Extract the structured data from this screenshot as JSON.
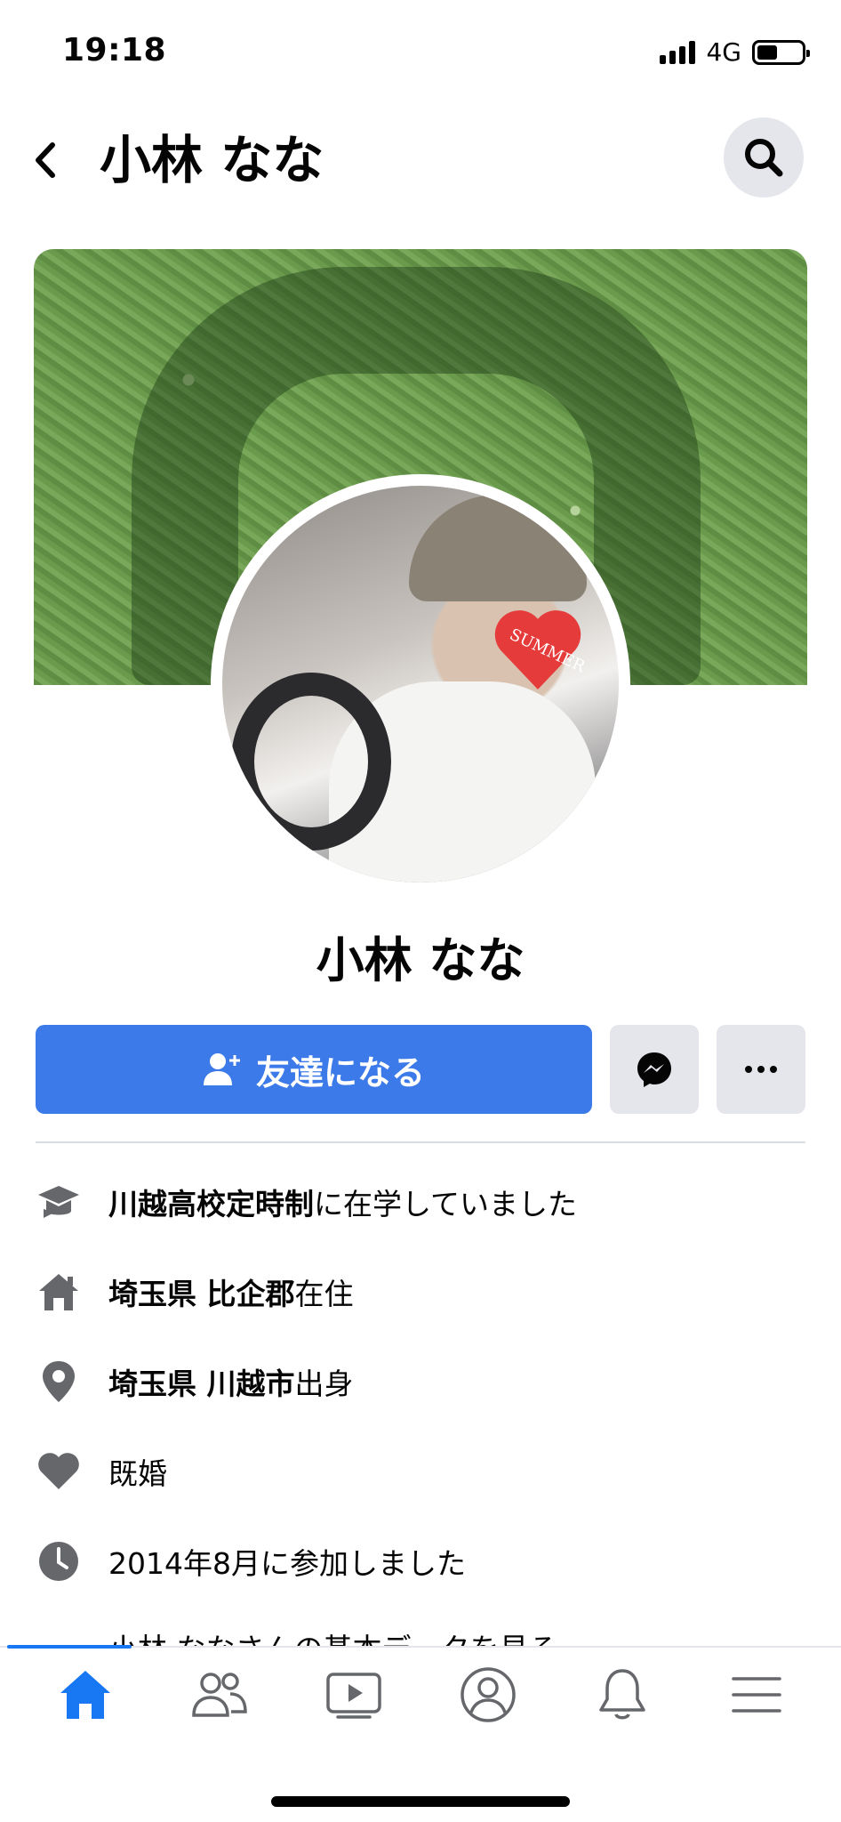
{
  "status_bar": {
    "time": "19:18",
    "network": "4G",
    "battery_level": 0.45
  },
  "header": {
    "title": "小林 なな",
    "back_icon": "chevron-left-icon",
    "search_icon": "search-icon"
  },
  "profile": {
    "name": "小林 なな",
    "avatar_sticker_text": "SUMMER"
  },
  "actions": {
    "add_friend_label": "友達になる",
    "add_friend_icon": "add-person-icon",
    "messenger_icon": "messenger-icon",
    "more_icon": "more-horizontal-icon",
    "primary_color": "#3b7ae8"
  },
  "info": {
    "education": {
      "bold": "川越高校定時制",
      "rest": "に在学していました",
      "icon": "graduation-cap-icon"
    },
    "lives_in": {
      "bold": "埼玉県 比企郡",
      "rest": "在住",
      "icon": "home-icon"
    },
    "from": {
      "bold": "埼玉県 川越市",
      "rest": "出身",
      "icon": "location-pin-icon"
    },
    "relationship": {
      "text": "既婚",
      "icon": "heart-icon"
    },
    "joined": {
      "text": "2014年8月に参加しました",
      "icon": "clock-icon"
    },
    "see_about": {
      "text": "小林 ななさんの基本データを見る",
      "icon": "more-horizontal-icon"
    }
  },
  "tab_bar": {
    "tabs": [
      "home-icon",
      "friends-icon",
      "watch-icon",
      "profile-icon",
      "notifications-icon",
      "menu-icon"
    ],
    "active": "home",
    "active_color": "#1877f2"
  }
}
